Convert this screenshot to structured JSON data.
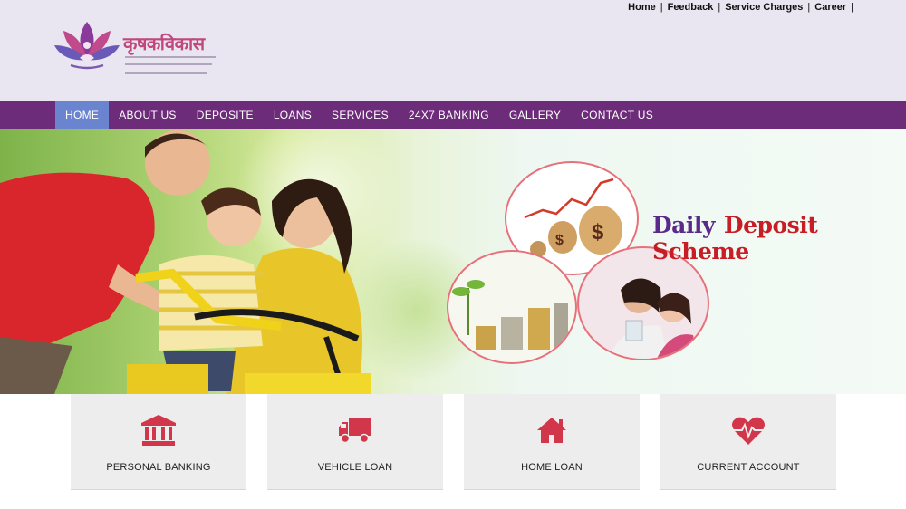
{
  "top_links": [
    "Home",
    "Feedback",
    "Service Charges",
    "Career"
  ],
  "logo": {
    "text": "कृषकविकास",
    "alt_label": "organization-logo"
  },
  "nav": {
    "items": [
      "HOME",
      "ABOUT US",
      "DEPOSITE",
      "LOANS",
      "SERVICES",
      "24X7 BANKING",
      "GALLERY",
      "CONTACT US"
    ],
    "active": "HOME"
  },
  "banner": {
    "title_word1": "Daily",
    "title_word2": "Deposit Scheme"
  },
  "services": [
    {
      "label": "PERSONAL BANKING",
      "icon": "bank-icon"
    },
    {
      "label": "VEHICLE LOAN",
      "icon": "truck-icon"
    },
    {
      "label": "HOME LOAN",
      "icon": "home-icon"
    },
    {
      "label": "CURRENT ACCOUNT",
      "icon": "heartbeat-icon"
    }
  ],
  "colors": {
    "nav_bg": "#6d2c79",
    "nav_active": "#6a84cf",
    "header_bg": "#e9e6f1",
    "icon_red": "#d2364a",
    "title_purple": "#5a2a8a",
    "title_red": "#c81d25"
  }
}
